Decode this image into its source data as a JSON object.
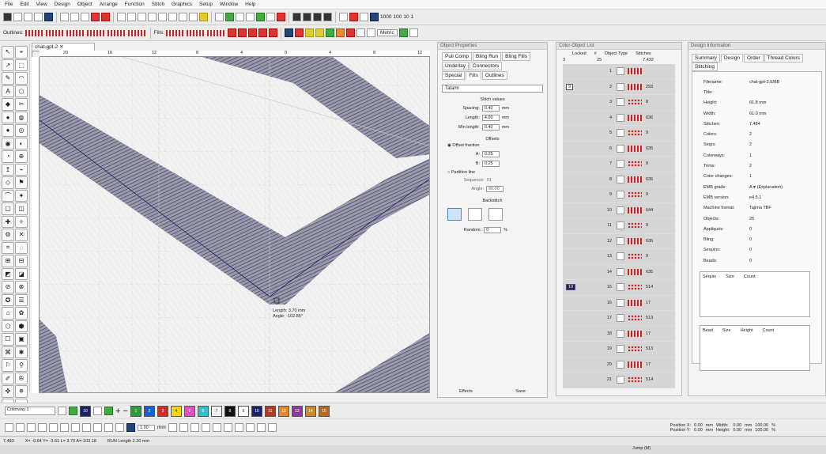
{
  "menu": [
    "File",
    "Edit",
    "View",
    "Design",
    "Object",
    "Arrange",
    "Function",
    "Stitch",
    "Graphics",
    "Setup",
    "Window",
    "Help"
  ],
  "toolbar2": {
    "outlines_label": "Outlines:",
    "fills_label": "Fills:",
    "zoom_right": "1000",
    "zoom_right2": "100",
    "zoom_right3": "10",
    "zoom_right4": "1",
    "units": "Metric"
  },
  "document": {
    "tab_label": "chat-gpt-2 ✕"
  },
  "ruler": {
    "h_ticks": [
      "20",
      "16",
      "12",
      "8",
      "4",
      "0",
      "4",
      "8",
      "12"
    ]
  },
  "tooltip": {
    "length": "Length:  3.70 mm",
    "angle": "Angle:  -102.85°"
  },
  "object_properties": {
    "header": "Object Properties",
    "tabs_row1": [
      "Pull Comp",
      "Bling Run",
      "Bling Fills"
    ],
    "tabs_row2": [
      "Underlay",
      "Connectors"
    ],
    "tabs_row3": [
      "Special",
      "Fills",
      "Outlines"
    ],
    "fill_type": "Tatami",
    "stitch_values_label": "Stitch values",
    "spacing_label": "Spacing:",
    "spacing": "0.40",
    "spacing_unit": "mm",
    "length_label": "Length:",
    "length": "4.00",
    "length_unit": "mm",
    "min_length_label": "Min length:",
    "min_length": "0.40",
    "min_length_unit": "mm",
    "offsets_label": "Offsets",
    "offset_fraction_label": "Offset fraction",
    "a_label": "A:",
    "a_value": "0.25",
    "b_label": "B:",
    "b_value": "0.25",
    "partition_label": "Partition line",
    "sequence_label": "Sequence:",
    "sequence": "01",
    "angle_label": "Angle:",
    "angle": "90.00",
    "backstitch_label": "Backstitch",
    "random_label": "Random:",
    "random": "0",
    "random_unit": "%",
    "effects_label": "Effects",
    "save_label": "Save"
  },
  "color_object_list": {
    "header": "Color-Object List",
    "col_locked": "Locked",
    "col_num": "#",
    "col_type": "Object Type",
    "col_stitches": "Stitches",
    "summary_colors": "3",
    "summary_objects": "25",
    "summary_stitches": "7,432",
    "group_a": "9",
    "group_b": "10",
    "rows": [
      {
        "num": "1",
        "stitches": ""
      },
      {
        "num": "2",
        "stitches": "293"
      },
      {
        "num": "3",
        "stitches": "8"
      },
      {
        "num": "4",
        "stitches": "636"
      },
      {
        "num": "5",
        "stitches": "9"
      },
      {
        "num": "6",
        "stitches": "635"
      },
      {
        "num": "7",
        "stitches": "9"
      },
      {
        "num": "8",
        "stitches": "635"
      },
      {
        "num": "9",
        "stitches": "9"
      },
      {
        "num": "10",
        "stitches": "644"
      },
      {
        "num": "11",
        "stitches": "9"
      },
      {
        "num": "12",
        "stitches": "635"
      },
      {
        "num": "13",
        "stitches": "9"
      },
      {
        "num": "14",
        "stitches": "635"
      },
      {
        "num": "15",
        "stitches": "514"
      },
      {
        "num": "16",
        "stitches": "17"
      },
      {
        "num": "17",
        "stitches": "513"
      },
      {
        "num": "18",
        "stitches": "17"
      },
      {
        "num": "19",
        "stitches": "513"
      },
      {
        "num": "20",
        "stitches": "17"
      },
      {
        "num": "21",
        "stitches": "514"
      }
    ]
  },
  "design_info": {
    "header": "Design Information",
    "tabs": [
      "Summary",
      "Design",
      "Order",
      "Thread Colors",
      "Stitching"
    ],
    "rows": [
      {
        "k": "Filename:",
        "v": "chat-gpt-2.EMB"
      },
      {
        "k": "Title:",
        "v": ""
      },
      {
        "k": "Height:",
        "v": "61.8 mm"
      },
      {
        "k": "Width:",
        "v": "61.0 mm"
      },
      {
        "k": "Stitches:",
        "v": "7,484"
      },
      {
        "k": "Colors:",
        "v": "2"
      },
      {
        "k": "Stops:",
        "v": "2"
      },
      {
        "k": "Colorways:",
        "v": "1"
      },
      {
        "k": "Trims:",
        "v": "2"
      },
      {
        "k": "Color changes:",
        "v": "1"
      },
      {
        "k": "EMB grade:",
        "v": "A ♥  (Explanation)"
      },
      {
        "k": "EMB version:",
        "v": "e4.5.1"
      },
      {
        "k": "Machine format:",
        "v": "Tajima TBF"
      },
      {
        "k": "Objects:",
        "v": "25"
      },
      {
        "k": "Appliqués:",
        "v": "0"
      },
      {
        "k": "Bling:",
        "v": "0"
      },
      {
        "k": "Sequins:",
        "v": "0"
      },
      {
        "k": "Beads:",
        "v": "0"
      }
    ],
    "sequin_cols": [
      "Sequin",
      "Size",
      "Count"
    ],
    "bead_cols": [
      "Bead",
      "Size",
      "Height",
      "Count"
    ]
  },
  "colorway": {
    "label": "Colorway 1",
    "current": "10",
    "swatches": [
      {
        "n": "1",
        "c": "#2a9d3a"
      },
      {
        "n": "2",
        "c": "#1a5fd1"
      },
      {
        "n": "3",
        "c": "#d42b2b"
      },
      {
        "n": "4",
        "c": "#f2d21a"
      },
      {
        "n": "5",
        "c": "#e44fc2"
      },
      {
        "n": "6",
        "c": "#35c0c8"
      },
      {
        "n": "7",
        "c": "#f0f0f0"
      },
      {
        "n": "8",
        "c": "#111111"
      },
      {
        "n": "9",
        "c": "#ffffff"
      },
      {
        "n": "10",
        "c": "#1c2266"
      },
      {
        "n": "11",
        "c": "#b33a1e"
      },
      {
        "n": "12",
        "c": "#e0892e"
      },
      {
        "n": "13",
        "c": "#8a3a9c"
      },
      {
        "n": "14",
        "c": "#c98a2c"
      },
      {
        "n": "15",
        "c": "#b56a22"
      }
    ]
  },
  "position": {
    "px_label": "Position X:",
    "px": "0.00",
    "py_label": "Position Y:",
    "py": "0.00",
    "unit": "mm",
    "w_label": "Width:",
    "w": "0.00",
    "h_label": "Height:",
    "h": "0.00",
    "wp": "100.00",
    "hp": "100.00",
    "pct": "%",
    "stepper": "1.00"
  },
  "status": {
    "count": "7,483",
    "coords": "X= -0.64 Y= -3.61 L= 3.70 A=-103.18",
    "run": "RUN Length  2.30 mm",
    "jump": "Jump (M)"
  },
  "colors": {
    "thread": "#1c2266",
    "panel_header": "#e0e3e8"
  }
}
